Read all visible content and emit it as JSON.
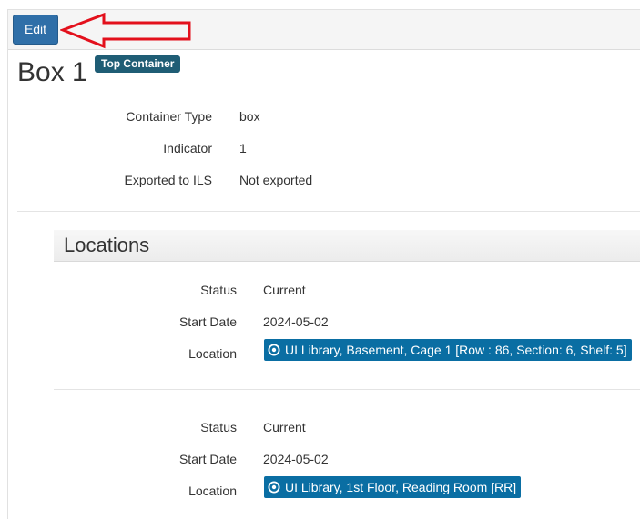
{
  "toolbar": {
    "edit_label": "Edit"
  },
  "record": {
    "title": "Box 1",
    "badge": "Top Container",
    "fields": [
      {
        "label": "Container Type",
        "value": "box"
      },
      {
        "label": "Indicator",
        "value": "1"
      },
      {
        "label": "Exported to ILS",
        "value": "Not exported"
      }
    ]
  },
  "locations": {
    "heading": "Locations",
    "entries": [
      {
        "status_label": "Status",
        "status": "Current",
        "start_label": "Start Date",
        "start_date": "2024-05-02",
        "location_label": "Location",
        "location": "UI Library, Basement, Cage 1 [Row : 86, Section: 6, Shelf: 5]"
      },
      {
        "status_label": "Status",
        "status": "Current",
        "start_label": "Start Date",
        "start_date": "2024-05-02",
        "location_label": "Location",
        "location": "UI Library, 1st Floor, Reading Room [RR]"
      }
    ]
  },
  "colors": {
    "edit_button": "#2f6fa8",
    "badge": "#1f5d75",
    "location_link": "#0a6ea3",
    "annotation_arrow": "#e3101c"
  },
  "annotation": {
    "icon": "red-arrow-icon"
  }
}
